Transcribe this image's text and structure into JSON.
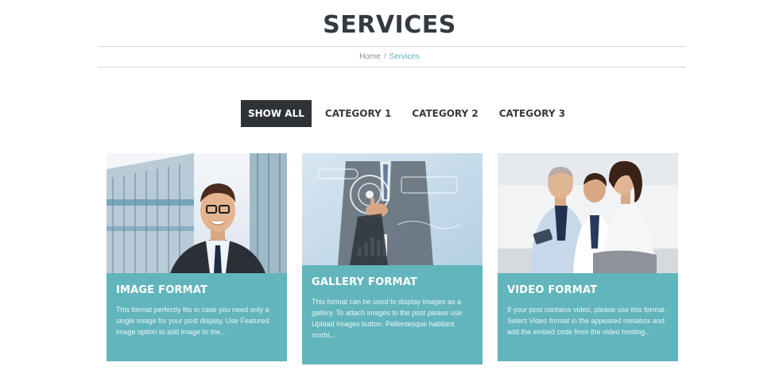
{
  "page": {
    "title": "SERVICES"
  },
  "breadcrumb": {
    "home": "Home",
    "separator": "/",
    "current": "Services"
  },
  "filters": [
    "SHOW ALL",
    "CATEGORY 1",
    "CATEGORY 2",
    "CATEGORY 3"
  ],
  "active_filter": "SHOW ALL",
  "cards": [
    {
      "title": "IMAGE FORMAT",
      "text": "This format perfectly fits in case you need only a single image for your post display. Use Featured image option to add image to the..."
    },
    {
      "title": "GALLERY FORMAT",
      "text": "This format can be used to display images as a gallery. To attach images to the post please use Upload Images button. Pellentesque habitant morbi..."
    },
    {
      "title": "VIDEO FORMAT",
      "text": "If your post contains video, please use this format. Select Video format in the appeared metabox and add the embed code from the video hosting..."
    }
  ],
  "colors": {
    "accent": "#62b5bc",
    "dark": "#2f3337",
    "title": "#343a40"
  }
}
